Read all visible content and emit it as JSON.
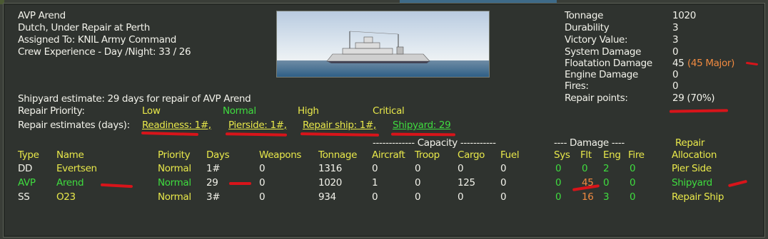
{
  "ship": {
    "name": "AVP Arend",
    "nationality_status": "Dutch, Under Repair at Perth",
    "assigned_to": "Assigned To:   KNIL Army Command",
    "crew_exp": "Crew Experience - Day /Night:  33  /  26"
  },
  "stats": [
    {
      "label": "Tonnage",
      "value": "1020"
    },
    {
      "label": "Durability",
      "value": "3"
    },
    {
      "label": "Victory Value:",
      "value": "3"
    },
    {
      "label": "System Damage",
      "value": "0"
    },
    {
      "label": "Floatation Damage",
      "value": "45",
      "extra": "(45 Major)"
    },
    {
      "label": "Engine Damage",
      "value": "0"
    },
    {
      "label": "Fires:",
      "value": "0"
    },
    {
      "label": "Repair points:",
      "value": "29 (70%)"
    }
  ],
  "shipyard_estimate": "Shipyard estimate: 29 days for repair of AVP Arend",
  "repair_priority": {
    "label": "Repair Priority:",
    "options": [
      "Low",
      "Normal",
      "High",
      "Critical"
    ]
  },
  "repair_estimates": {
    "label": "Repair estimates (days):",
    "options": [
      "Readiness: 1#,",
      "Pierside: 1#,",
      "Repair ship: 1#,",
      "Shipyard: 29"
    ]
  },
  "table": {
    "group_headers": {
      "capacity": "------------- Capacity -----------",
      "damage": "---- Damage ----",
      "repair": "Repair"
    },
    "columns": [
      "Type",
      "Name",
      "Priority",
      "Days",
      "Weapons",
      "Tonnage",
      "Aircraft",
      "Troop",
      "Cargo",
      "Fuel",
      "Sys",
      "Flt",
      "Eng",
      "Fire",
      "Allocation"
    ],
    "rows": [
      {
        "type": "DD",
        "name": "Evertsen",
        "priority": "Normal",
        "days": "1#",
        "weapons": "0",
        "tonnage": "1316",
        "aircraft": "0",
        "troop": "0",
        "cargo": "0",
        "fuel": "0",
        "sys": "0",
        "flt": "0",
        "eng": "2",
        "fire": "0",
        "allocation": "Pier Side"
      },
      {
        "type": "AVP",
        "name": "Arend",
        "priority": "Normal",
        "days": "29",
        "weapons": "0",
        "tonnage": "1020",
        "aircraft": "1",
        "troop": "0",
        "cargo": "125",
        "fuel": "0",
        "sys": "0",
        "flt": "45",
        "eng": "0",
        "fire": "0",
        "allocation": "Shipyard"
      },
      {
        "type": "SS",
        "name": "O23",
        "priority": "Normal",
        "days": "3#",
        "weapons": "0",
        "tonnage": "934",
        "aircraft": "0",
        "troop": "0",
        "cargo": "0",
        "fuel": "0",
        "sys": "0",
        "flt": "16",
        "eng": "3",
        "fire": "0",
        "allocation": "Repair Ship"
      }
    ]
  },
  "colors": {
    "white": "#f2f2ea",
    "yellow": "#e8e84a",
    "green": "#3fdc3f",
    "orange": "#f08a40",
    "annotation": "#d8141a"
  }
}
